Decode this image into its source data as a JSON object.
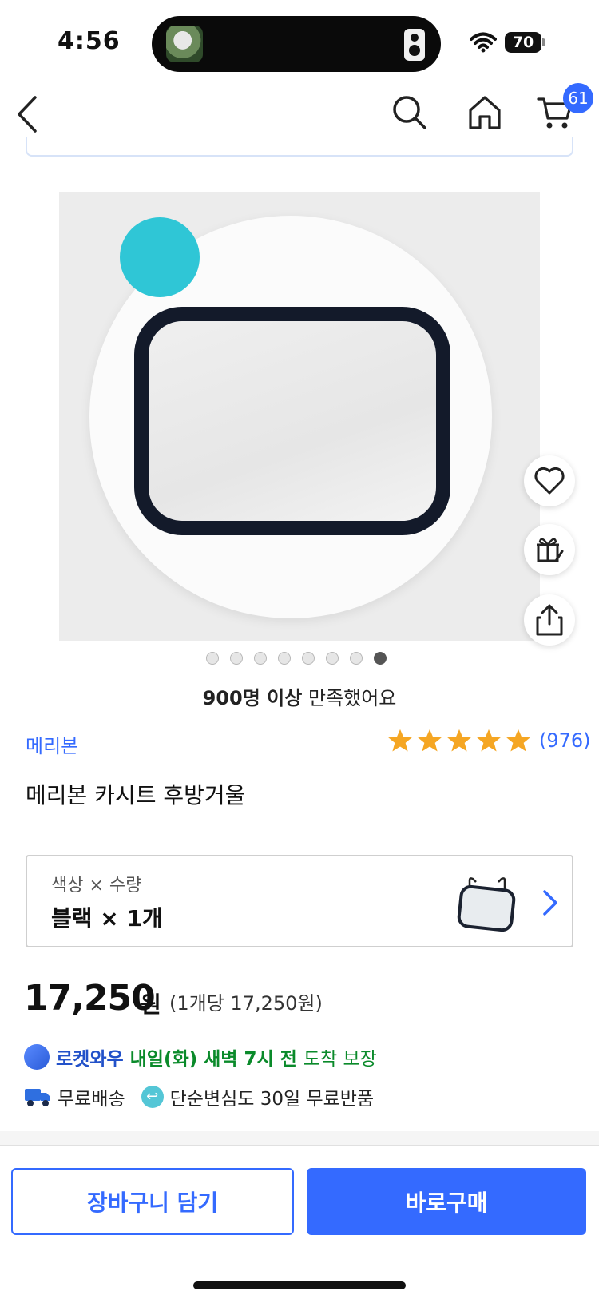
{
  "status_bar": {
    "time": "4:56",
    "battery": "70"
  },
  "nav": {
    "cart_count": "61"
  },
  "product": {
    "satisfaction_strong": "900명 이상",
    "satisfaction_rest": " 만족했어요",
    "brand": "메리본",
    "rating_value": 5,
    "rating_count": "(976)",
    "title": "메리본 카시트 후방거울",
    "image_page_count": 8,
    "image_page_active": 8
  },
  "option": {
    "label": "색상 × 수량",
    "value": "블랙 × 1개"
  },
  "pricing": {
    "price": "17,250",
    "currency": "원",
    "unit_price": "(1개당 17,250원)"
  },
  "shipping": {
    "rocket_label": "로켓와우",
    "arrival": "내일(화) 새벽 7시 전",
    "arrival_suffix": "도착 보장",
    "free_shipping": "무료배송",
    "return_policy": "단순변심도 30일 무료반품"
  },
  "actions": {
    "add_to_cart": "장바구니 담기",
    "buy_now": "바로구매"
  },
  "colors": {
    "accent": "#346aff",
    "delivery": "#0a8a2a",
    "star": "#f5a623"
  }
}
